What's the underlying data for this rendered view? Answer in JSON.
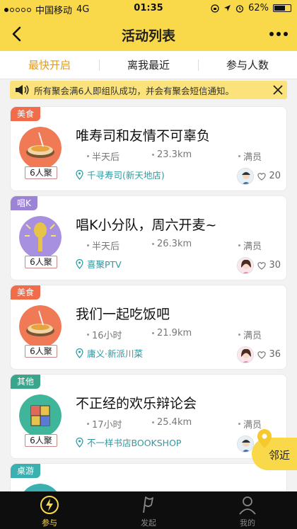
{
  "status_bar": {
    "carrier": "中国移动",
    "network": "4G",
    "time": "01:35",
    "battery": "62%"
  },
  "header": {
    "title": "活动列表"
  },
  "tabs": [
    {
      "label": "最快开启",
      "active": true
    },
    {
      "label": "离我最近",
      "active": false
    },
    {
      "label": "参与人数",
      "active": false
    }
  ],
  "notice": {
    "text": "所有聚会满6人即组队成功，并会有聚会短信通知。"
  },
  "events": [
    {
      "category": "美食",
      "category_color": "#f06c4a",
      "title": "唯寿司和友情不可辜负",
      "people": "6人聚",
      "time": "半天后",
      "distance": "23.3km",
      "status": "满员",
      "location": "千寻寿司(新天地店)",
      "likes": "20"
    },
    {
      "category": "唱K",
      "category_color": "#9b84d6",
      "title": "唱K小分队，周六开麦~",
      "people": "6人聚",
      "time": "半天后",
      "distance": "26.3km",
      "status": "满员",
      "location": "喜聚PTV",
      "likes": "30"
    },
    {
      "category": "美食",
      "category_color": "#f06c4a",
      "title": "我们一起吃饭吧",
      "people": "6人聚",
      "time": "16小时",
      "distance": "21.9km",
      "status": "满员",
      "location": "庸义·新派川菜",
      "likes": "36"
    },
    {
      "category": "其他",
      "category_color": "#3aa58a",
      "title": "不正经的欢乐辩论会",
      "people": "6人聚",
      "time": "17小时",
      "distance": "25.4km",
      "status": "满员",
      "location": "不一样书店BOOKSHOP",
      "likes": ""
    },
    {
      "category": "桌游",
      "category_color": "#3bb0b0",
      "title": "",
      "people": "",
      "time": "",
      "distance": "",
      "status": "",
      "location": "",
      "likes": ""
    }
  ],
  "nearby_button": {
    "label": "邻近"
  },
  "tabbar": [
    {
      "label": "参与",
      "icon": "lightning-icon",
      "active": true
    },
    {
      "label": "发起",
      "icon": "flag-icon",
      "active": false
    },
    {
      "label": "我的",
      "icon": "person-icon",
      "active": false
    }
  ]
}
